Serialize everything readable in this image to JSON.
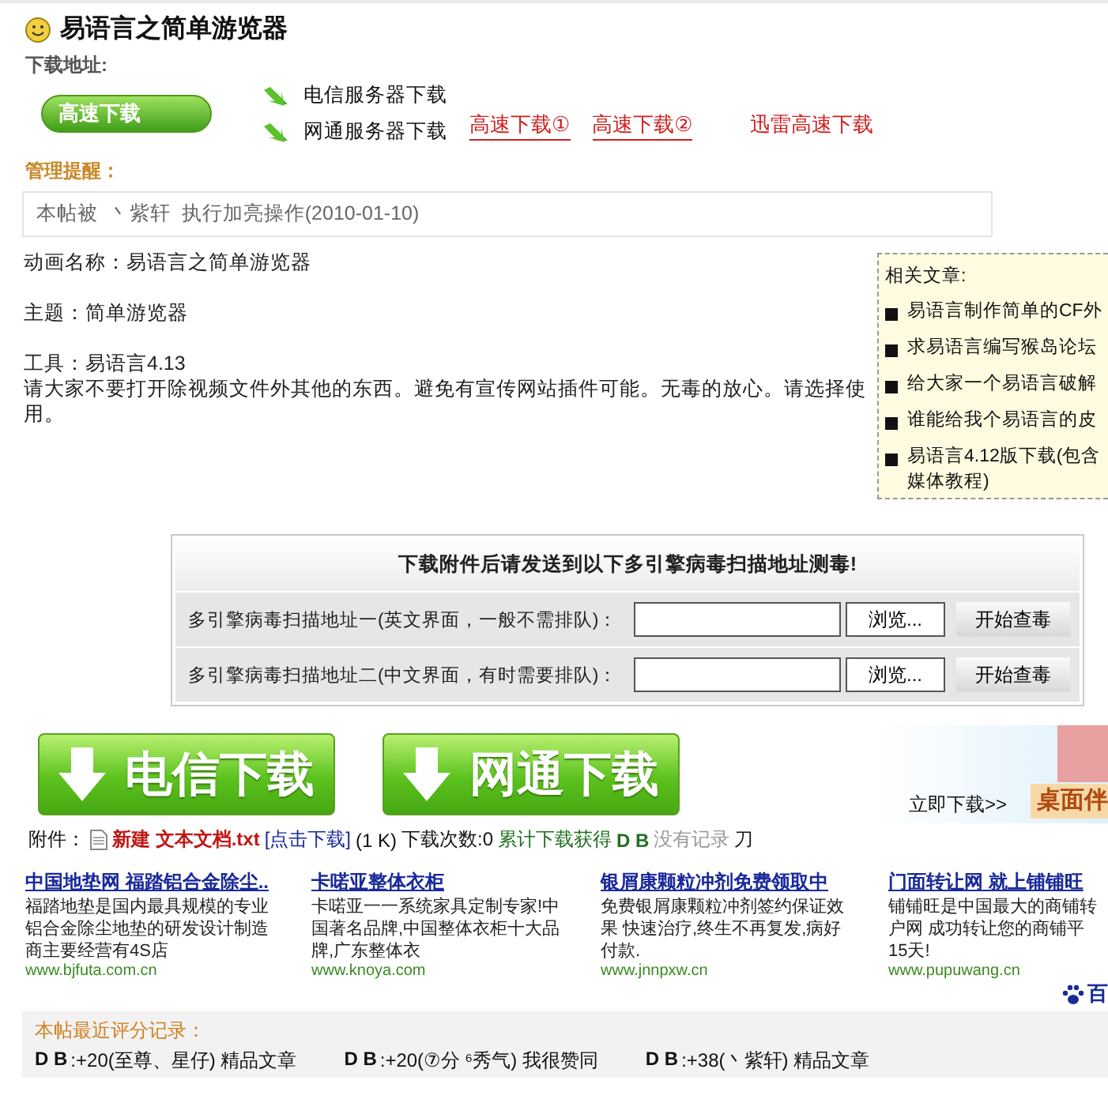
{
  "title": "易语言之简单游览器",
  "download_label": "下载地址:",
  "fast_download_button": "高速下载",
  "server_links": [
    "电信服务器下载",
    "网通服务器下载"
  ],
  "fast_links": [
    "高速下载①",
    "高速下载②"
  ],
  "thunder_link": "迅雷高速下载",
  "admin_notice": {
    "label": "管理提醒：",
    "text": "本帖被  丶紫轩  执行加亮操作(2010-01-10)"
  },
  "post": {
    "lines": [
      "动画名称：易语言之简单游览器",
      "主题：简单游览器",
      "工具：易语言4.13"
    ],
    "paragraph": "请大家不要打开除视频文件外其他的东西。避免有宣传网站插件可能。无毒的放心。请选择使用。"
  },
  "related": {
    "title": "相关文章:",
    "items": [
      {
        "lines": [
          "易语言制作简单的CF外"
        ]
      },
      {
        "lines": [
          "求易语言编写猴岛论坛"
        ]
      },
      {
        "lines": [
          "给大家一个易语言破解"
        ]
      },
      {
        "lines": [
          "谁能给我个易语言的皮"
        ]
      },
      {
        "lines": [
          "易语言4.12版下载(包含",
          "媒体教程)"
        ]
      }
    ]
  },
  "scan": {
    "heading": "下载附件后请发送到以下多引擎病毒扫描地址测毒!",
    "rows": [
      {
        "label": "多引擎病毒扫描地址一(英文界面，一般不需排队)：",
        "browse": "浏览...",
        "start": "开始查毒"
      },
      {
        "label": "多引擎病毒扫描地址二(中文界面，有时需要排队)：",
        "browse": "浏览...",
        "start": "开始查毒"
      }
    ]
  },
  "big_buttons": [
    "电信下载",
    "网通下载"
  ],
  "banner": {
    "cta": "立即下载>>",
    "title": "桌面伴"
  },
  "attachment": {
    "label": "附件：",
    "file": "新建 文本文档.txt",
    "link": "[点击下载]",
    "size": "(1 K)",
    "count": "下载次数:0",
    "earned": "累计下载获得",
    "currency": "D B",
    "record": "没有记录",
    "tail": "刀"
  },
  "ads": [
    {
      "title": "中国地垫网 福踏铝合金除尘..",
      "desc": [
        "福踏地垫是国内最具规模的专业",
        "铝合金除尘地垫的研发设计制造",
        "商主要经营有4S店"
      ],
      "url": "www.bjfuta.com.cn"
    },
    {
      "title": "卡喏亚整体衣柜",
      "desc": [
        "卡喏亚一一系统家具定制专家!中",
        "国著名品牌,中国整体衣柜十大品",
        "牌,广东整体衣"
      ],
      "url": "www.knoya.com"
    },
    {
      "title": "银屑康颗粒冲剂免费领取中",
      "desc": [
        "免费银屑康颗粒冲剂签约保证效",
        "果 快速治疗,终生不再复发,病好",
        "付款."
      ],
      "url": "www.jnnpxw.cn"
    },
    {
      "title": "门面转让网 就上铺铺旺",
      "desc": [
        "铺铺旺是中国最大的商铺转",
        "户网 成功转让您的商铺平",
        "15天!"
      ],
      "url": "www.pupuwang.cn"
    }
  ],
  "ad_brand": "百",
  "ratings": {
    "title": "本帖最近评分记录：",
    "entries": [
      {
        "currency": "D B",
        "text": ":+20(至尊、星仔) 精品文章"
      },
      {
        "currency": "D B",
        "text": ":+20(⑦分 ⁶秀气) 我很赞同"
      },
      {
        "currency": "D B",
        "text": ":+38(丶紫轩) 精品文章"
      }
    ]
  }
}
